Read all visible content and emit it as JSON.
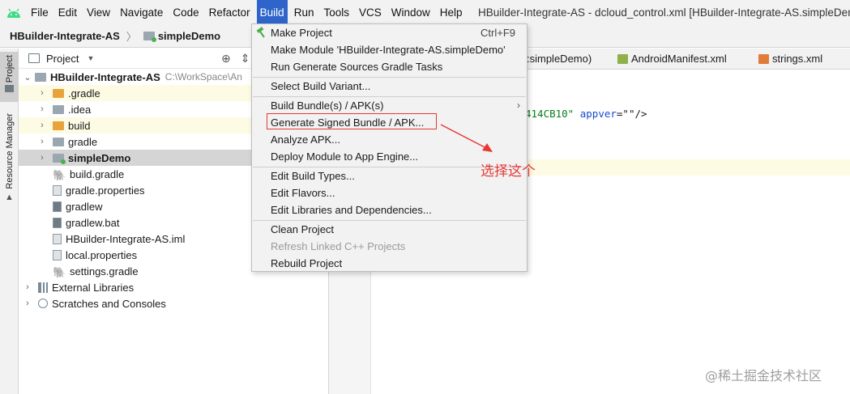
{
  "menubar": {
    "items": [
      "File",
      "Edit",
      "View",
      "Navigate",
      "Code",
      "Refactor",
      "Build",
      "Run",
      "Tools",
      "VCS",
      "Window",
      "Help"
    ],
    "active": "Build",
    "window_title": "HBuilder-Integrate-AS - dcloud_control.xml [HBuilder-Integrate-AS.simpleDemo]"
  },
  "breadcrumb": {
    "project": "HBuilder-Integrate-AS",
    "module": "simpleDemo"
  },
  "toolstrip": {
    "project_tab": "Project",
    "resource_tab": "Resource Manager"
  },
  "project_panel": {
    "header": "Project",
    "root": {
      "label": "HBuilder-Integrate-AS",
      "path": "C:\\WorkSpace\\An"
    },
    "rows": [
      {
        "label": ".gradle"
      },
      {
        "label": ".idea"
      },
      {
        "label": "build"
      },
      {
        "label": "gradle"
      },
      {
        "label": "simpleDemo"
      },
      {
        "label": "build.gradle"
      },
      {
        "label": "gradle.properties"
      },
      {
        "label": "gradlew"
      },
      {
        "label": "gradlew.bat"
      },
      {
        "label": "HBuilder-Integrate-AS.iml"
      },
      {
        "label": "local.properties"
      },
      {
        "label": "settings.gradle"
      },
      {
        "label": "External Libraries"
      },
      {
        "label": "Scratches and Consoles"
      }
    ]
  },
  "editor": {
    "tabs": [
      ":simpleDemo)",
      "AndroidManifest.xml",
      "strings.xml"
    ],
    "code": {
      "str": "414CB10\"",
      "attr": "appver",
      "rest": "=\"\"/>"
    }
  },
  "build_menu": {
    "items": [
      {
        "label": "Make Project",
        "shortcut": "Ctrl+F9"
      },
      {
        "label": "Make Module 'HBuilder-Integrate-AS.simpleDemo'"
      },
      {
        "label": "Run Generate Sources Gradle Tasks"
      },
      {
        "label": "Select Build Variant..."
      },
      {
        "label": "Build Bundle(s) / APK(s)"
      },
      {
        "label": "Generate Signed Bundle / APK..."
      },
      {
        "label": "Analyze APK..."
      },
      {
        "label": "Deploy Module to App Engine..."
      },
      {
        "label": "Edit Build Types..."
      },
      {
        "label": "Edit Flavors..."
      },
      {
        "label": "Edit Libraries and Dependencies..."
      },
      {
        "label": "Clean Project"
      },
      {
        "label": "Refresh Linked C++ Projects"
      },
      {
        "label": "Rebuild Project"
      }
    ]
  },
  "annotation": {
    "text": "选择这个",
    "color": "#e53935"
  },
  "watermark": "@稀土掘金技术社区",
  "colors": {
    "menu_active": "#2f65ca",
    "highlight_row": "#fefbe5",
    "selected_row": "#d5d5d5"
  }
}
